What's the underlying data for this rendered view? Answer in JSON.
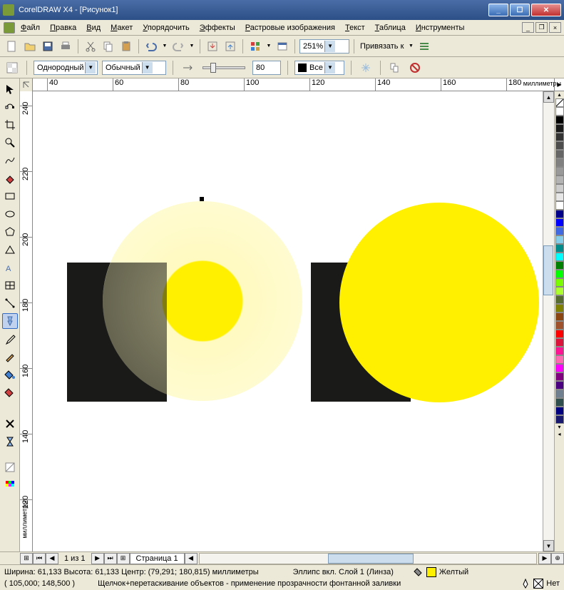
{
  "title": "CorelDRAW X4 - [Рисунок1]",
  "menu": [
    "Файл",
    "Правка",
    "Вид",
    "Макет",
    "Упорядочить",
    "Эффекты",
    "Растровые изображения",
    "Текст",
    "Таблица",
    "Инструменты"
  ],
  "menu_underline": [
    "Ф",
    "П",
    "В",
    "М",
    "У",
    "Э",
    "Р",
    "Т",
    "Т",
    "И"
  ],
  "zoom": "251%",
  "snap_label": "Привязать к",
  "hairline": "Однородный",
  "style": "Обычный",
  "width_val": "80",
  "all_label": "Все",
  "ruler_h": [
    "40",
    "60",
    "80",
    "100",
    "120",
    "140",
    "160",
    "180"
  ],
  "ruler_h_unit": "миллиметры",
  "ruler_v": [
    "240",
    "220",
    "200",
    "180",
    "160",
    "140",
    "120"
  ],
  "ruler_v_unit": "миллиметры",
  "page_info": "1 из 1",
  "page_tab": "Страница 1",
  "status_dim": "Ширина: 61,133 Высота: 61,133 Центр: (79,291; 180,815) миллиметры",
  "status_sel": "Эллипс вкл. Слой 1  (Линза)",
  "status_fill": "Желтый",
  "status_outline": "Нет",
  "status_coord": "( 105,000; 148,500 )",
  "status_hint": "Щелчок+перетаскивание объектов - применение прозрачности фонтанной заливки",
  "palette_colors": [
    "#ffffff",
    "#000000",
    "#1a1a1a",
    "#333333",
    "#4d4d4d",
    "#666666",
    "#808080",
    "#999999",
    "#b3b3b3",
    "#cccccc",
    "#e6e6e6",
    "#ffffff",
    "#00008b",
    "#0000ff",
    "#4169e1",
    "#87ceeb",
    "#008b8b",
    "#00ffff",
    "#008000",
    "#00ff00",
    "#7cfc00",
    "#adff2f",
    "#556b2f",
    "#808000",
    "#8b4513",
    "#a0522d",
    "#ff0000",
    "#dc143c",
    "#ff1493",
    "#ff69b4",
    "#ff00ff",
    "#800080",
    "#4b0082",
    "#708090",
    "#2f4f4f",
    "#000080",
    "#191970"
  ]
}
